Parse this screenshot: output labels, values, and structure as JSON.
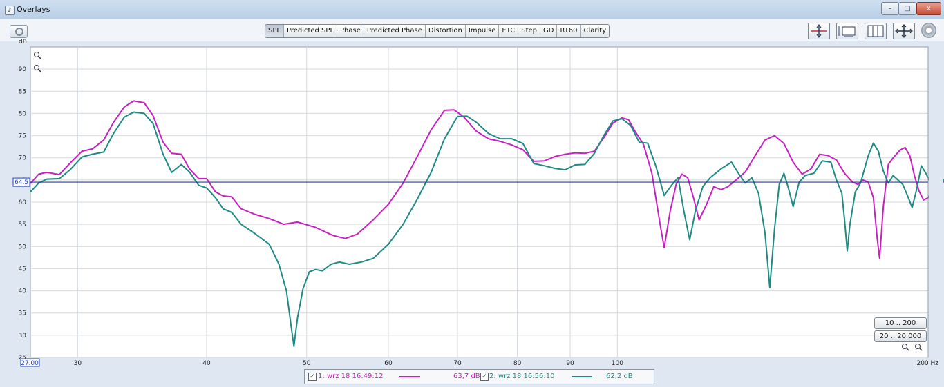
{
  "window": {
    "title": "Overlays",
    "minimize_label": "–",
    "maximize_label": "□",
    "close_label": "x"
  },
  "toolbar": {
    "tabs": [
      "SPL",
      "Predicted SPL",
      "Phase",
      "Predicted Phase",
      "Distortion",
      "Impulse",
      "ETC",
      "Step",
      "GD",
      "RT60",
      "Clarity"
    ],
    "active_tab": "SPL",
    "icons": [
      "camera-icon",
      "vertical-zoom-icon",
      "window-range-icon",
      "grid-columns-icon",
      "fit-all-arrows-icon",
      "gear-icon"
    ]
  },
  "range_buttons": {
    "narrow": "10 .. 200",
    "wide": "20 .. 20 000"
  },
  "legend": {
    "items": [
      {
        "label": "1: wrz 18 16:49:12",
        "value": "63,7 dB",
        "color": "#c81fbf",
        "checked": true
      },
      {
        "label": "2: wrz 18 16:56:10",
        "value": "62,2 dB",
        "color": "#1e8a84",
        "checked": true
      }
    ]
  },
  "chart_data": {
    "type": "line",
    "ylabel": "dB",
    "xlabel": "Hz",
    "x_scale": "log",
    "xlim": [
      27,
      200
    ],
    "ylim": [
      25,
      95
    ],
    "y_ticks": [
      25,
      30,
      35,
      40,
      45,
      50,
      55,
      60,
      65,
      70,
      75,
      80,
      85,
      90
    ],
    "x_ticks": [
      30,
      40,
      50,
      60,
      70,
      80,
      90,
      100
    ],
    "x_tick_labels": [
      "30",
      "40",
      "50",
      "60",
      "70",
      "80",
      "90",
      "100"
    ],
    "x_start_label": "27.00",
    "x_end_label": "200 Hz",
    "cursor_value": 64.5,
    "cursor_label": "64,5",
    "grid": true,
    "series": [
      {
        "color": "#c81fbf",
        "points": [
          [
            27,
            64.2
          ],
          [
            27.5,
            66.3
          ],
          [
            28,
            66.7
          ],
          [
            28.8,
            66.2
          ],
          [
            29.5,
            68.8
          ],
          [
            30.3,
            71.5
          ],
          [
            31,
            72
          ],
          [
            31.8,
            74
          ],
          [
            32.5,
            78
          ],
          [
            33.3,
            81.5
          ],
          [
            34,
            82.8
          ],
          [
            34.8,
            82.4
          ],
          [
            35.5,
            79.5
          ],
          [
            36.3,
            73.5
          ],
          [
            37,
            71
          ],
          [
            37.8,
            70.8
          ],
          [
            38.5,
            67.5
          ],
          [
            39.3,
            65.3
          ],
          [
            40,
            65.3
          ],
          [
            40.8,
            62.3
          ],
          [
            41.5,
            61.4
          ],
          [
            42.3,
            61.2
          ],
          [
            43.2,
            58.5
          ],
          [
            44.5,
            57.3
          ],
          [
            46,
            56.3
          ],
          [
            47.5,
            55
          ],
          [
            49,
            55.5
          ],
          [
            51,
            54.3
          ],
          [
            53,
            52.5
          ],
          [
            54.5,
            51.8
          ],
          [
            56,
            52.8
          ],
          [
            58,
            56
          ],
          [
            60,
            59.5
          ],
          [
            62,
            64.3
          ],
          [
            64,
            70.3
          ],
          [
            66,
            76.3
          ],
          [
            68,
            80.7
          ],
          [
            69.5,
            80.8
          ],
          [
            71,
            79.2
          ],
          [
            73,
            76
          ],
          [
            75,
            74.3
          ],
          [
            77,
            73.7
          ],
          [
            79,
            72.9
          ],
          [
            81,
            71.8
          ],
          [
            83,
            69.2
          ],
          [
            85,
            69.3
          ],
          [
            87,
            70.3
          ],
          [
            89,
            70.8
          ],
          [
            91,
            71.1
          ],
          [
            93,
            71
          ],
          [
            95,
            71.5
          ],
          [
            97,
            74.5
          ],
          [
            99,
            77.8
          ],
          [
            101,
            79
          ],
          [
            102.5,
            78.6
          ],
          [
            104,
            76
          ],
          [
            106,
            73
          ],
          [
            108,
            66.5
          ],
          [
            110,
            55
          ],
          [
            111,
            49.7
          ],
          [
            112.5,
            58
          ],
          [
            114,
            64
          ],
          [
            115.5,
            66.3
          ],
          [
            117,
            65.5
          ],
          [
            118.5,
            61
          ],
          [
            120,
            56
          ],
          [
            122,
            59.5
          ],
          [
            124,
            63.5
          ],
          [
            126,
            62.8
          ],
          [
            128,
            63.5
          ],
          [
            130,
            64.8
          ],
          [
            133,
            66.8
          ],
          [
            136,
            70.5
          ],
          [
            139,
            74
          ],
          [
            142,
            75
          ],
          [
            145,
            73.2
          ],
          [
            148,
            69
          ],
          [
            151,
            66.3
          ],
          [
            154,
            67.5
          ],
          [
            157,
            70.8
          ],
          [
            160,
            70.5
          ],
          [
            163,
            69.5
          ],
          [
            166,
            66.5
          ],
          [
            169,
            64.5
          ],
          [
            171,
            64
          ],
          [
            173,
            65
          ],
          [
            175,
            64.5
          ],
          [
            177,
            61
          ],
          [
            178.5,
            52
          ],
          [
            179.5,
            47.3
          ],
          [
            181,
            59
          ],
          [
            183,
            68.5
          ],
          [
            185,
            70
          ],
          [
            188,
            71.8
          ],
          [
            190,
            72.3
          ],
          [
            192,
            70.5
          ],
          [
            194,
            66
          ],
          [
            196,
            62.5
          ],
          [
            198,
            60.5
          ],
          [
            200,
            61
          ],
          [
            202,
            62.5
          ],
          [
            204,
            64.3
          ],
          [
            206,
            65
          ],
          [
            208,
            64.2
          ],
          [
            210,
            67.3
          ]
        ]
      },
      {
        "color": "#1e8a84",
        "points": [
          [
            27,
            62.3
          ],
          [
            27.5,
            64.3
          ],
          [
            28,
            65.2
          ],
          [
            28.8,
            65.3
          ],
          [
            29.5,
            67.3
          ],
          [
            30.3,
            70.2
          ],
          [
            31,
            70.8
          ],
          [
            31.8,
            71.3
          ],
          [
            32.5,
            75.5
          ],
          [
            33.3,
            79.2
          ],
          [
            34,
            80.3
          ],
          [
            34.8,
            80
          ],
          [
            35.5,
            77.7
          ],
          [
            36.3,
            70.8
          ],
          [
            37,
            66.7
          ],
          [
            37.8,
            68.5
          ],
          [
            38.5,
            66.8
          ],
          [
            39.3,
            63.8
          ],
          [
            40,
            63.2
          ],
          [
            40.8,
            61
          ],
          [
            41.5,
            58.5
          ],
          [
            42.3,
            57.7
          ],
          [
            43.2,
            55
          ],
          [
            44.5,
            53
          ],
          [
            46,
            50.5
          ],
          [
            47,
            46
          ],
          [
            47.8,
            40
          ],
          [
            48.3,
            32
          ],
          [
            48.6,
            27.5
          ],
          [
            49,
            34
          ],
          [
            49.6,
            40.5
          ],
          [
            50.3,
            44.3
          ],
          [
            51,
            44.8
          ],
          [
            51.8,
            44.5
          ],
          [
            52.8,
            46
          ],
          [
            53.8,
            46.5
          ],
          [
            55,
            46
          ],
          [
            56.5,
            46.5
          ],
          [
            58,
            47.3
          ],
          [
            60,
            50.5
          ],
          [
            62,
            55
          ],
          [
            64,
            60.7
          ],
          [
            66,
            66.7
          ],
          [
            68,
            74.3
          ],
          [
            70,
            79.3
          ],
          [
            71.5,
            79.4
          ],
          [
            73,
            78
          ],
          [
            75,
            75.5
          ],
          [
            77,
            74.3
          ],
          [
            79,
            74.3
          ],
          [
            81,
            73.2
          ],
          [
            83,
            68.7
          ],
          [
            85,
            68.2
          ],
          [
            87,
            67.6
          ],
          [
            89,
            67.3
          ],
          [
            91,
            68.4
          ],
          [
            93,
            68.5
          ],
          [
            95,
            71
          ],
          [
            97,
            75
          ],
          [
            99,
            78.3
          ],
          [
            101,
            78.8
          ],
          [
            103,
            77.3
          ],
          [
            105,
            73.5
          ],
          [
            107,
            73.3
          ],
          [
            109,
            68
          ],
          [
            111,
            61.5
          ],
          [
            113,
            64
          ],
          [
            114.5,
            65.5
          ],
          [
            116,
            58
          ],
          [
            117.5,
            51.5
          ],
          [
            119,
            58
          ],
          [
            121,
            63.5
          ],
          [
            123,
            65.5
          ],
          [
            126,
            67.5
          ],
          [
            129,
            69
          ],
          [
            131,
            66.5
          ],
          [
            133,
            64.3
          ],
          [
            135,
            65.5
          ],
          [
            137,
            62
          ],
          [
            139,
            53
          ],
          [
            140.5,
            40.7
          ],
          [
            142,
            54
          ],
          [
            143.5,
            64
          ],
          [
            145,
            66.5
          ],
          [
            146.5,
            63
          ],
          [
            148,
            59
          ],
          [
            150,
            64.5
          ],
          [
            152,
            66
          ],
          [
            155,
            66.5
          ],
          [
            158,
            69.3
          ],
          [
            161,
            69
          ],
          [
            163,
            65
          ],
          [
            165,
            62
          ],
          [
            166,
            56
          ],
          [
            167,
            49
          ],
          [
            168,
            55
          ],
          [
            170,
            62.3
          ],
          [
            172,
            64.3
          ],
          [
            175,
            70.5
          ],
          [
            177,
            73.3
          ],
          [
            179,
            71.5
          ],
          [
            181,
            67
          ],
          [
            183,
            64.3
          ],
          [
            185,
            66
          ],
          [
            187,
            65
          ],
          [
            189,
            64
          ],
          [
            191,
            61.5
          ],
          [
            193,
            58.8
          ],
          [
            195,
            63
          ],
          [
            197,
            68.2
          ],
          [
            199,
            66.5
          ],
          [
            201,
            64.5
          ],
          [
            203,
            64.2
          ],
          [
            205,
            63.7
          ],
          [
            207,
            65
          ],
          [
            210,
            66
          ]
        ]
      }
    ]
  }
}
